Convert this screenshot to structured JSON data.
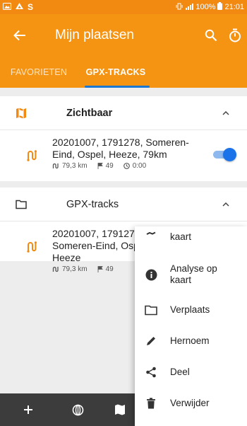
{
  "statusbar": {
    "signal": "100%",
    "time": "21:01"
  },
  "appbar": {
    "title": "Mijn plaatsen"
  },
  "tabs": [
    {
      "label": "FAVORIETEN"
    },
    {
      "label": "GPX-TRACKS"
    }
  ],
  "sections": [
    {
      "title": "Zichtbaar",
      "track": {
        "name": "20201007, 1791278, Someren-Eind, Ospel, Heeze, 79km",
        "distance": "79,3 km",
        "points": "49",
        "time": "0:00",
        "visible": true
      }
    },
    {
      "title": "GPX-tracks",
      "track": {
        "name": "20201007, 1791278, Someren-Eind, Ospel, Heeze",
        "distance": "79,3 km",
        "points": "49",
        "time": ""
      }
    }
  ],
  "context_menu": [
    {
      "label": "kaart",
      "icon": "partial-icon"
    },
    {
      "label": "Analyse op kaart",
      "icon": "info-icon"
    },
    {
      "label": "Verplaats",
      "icon": "folder-icon"
    },
    {
      "label": "Hernoem",
      "icon": "pencil-icon"
    },
    {
      "label": "Deel",
      "icon": "share-icon"
    },
    {
      "label": "Verwijder",
      "icon": "trash-icon"
    }
  ],
  "colors": {
    "accent": "#f59313",
    "toggle": "#1a73e8",
    "bottombar": "#3c3c3c"
  }
}
